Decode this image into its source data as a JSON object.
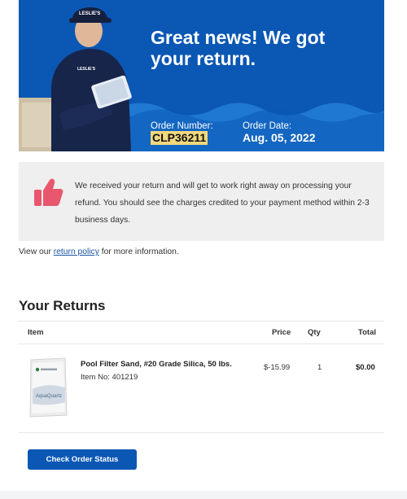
{
  "hero": {
    "headline": "Great news! We got your return.",
    "order_number_label": "Order Number:",
    "order_number": "CLP36211",
    "order_date_label": "Order Date:",
    "order_date": "Aug. 05, 2022",
    "brand_on_cap": "LESLIE'S",
    "colors": {
      "hero_blue": "#0a57b4",
      "wave_blue": "#1f78d1",
      "highlight": "#f3d87d"
    }
  },
  "notice": {
    "icon": "thumbs-up-icon",
    "text": "We received your return and will get to work right away on processing your refund. You should see the charges credited to your payment method within 2-3 business days."
  },
  "policy": {
    "prefix": "View our",
    "link": "return policy",
    "suffix": "for more information."
  },
  "returns": {
    "title": "Your Returns",
    "columns": {
      "item": "Item",
      "price": "Price",
      "qty": "Qty",
      "total": "Total"
    },
    "items": [
      {
        "name": "Pool Filter Sand, #20 Grade Silica, 50 lbs.",
        "item_no": "Item No: 401219",
        "price": "$-15.99",
        "qty": "1",
        "total": "$0.00",
        "bag_label": "AquaQuartz"
      }
    ]
  },
  "actions": {
    "check_status": "Check Order Status"
  }
}
